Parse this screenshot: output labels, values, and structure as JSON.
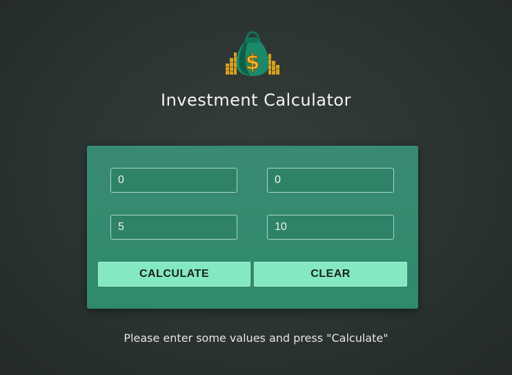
{
  "app": {
    "title": "Investment Calculator",
    "logo_icon": "money-bag-icon"
  },
  "form": {
    "fields": [
      {
        "value": "0"
      },
      {
        "value": "0"
      },
      {
        "value": "5"
      },
      {
        "value": "10"
      }
    ],
    "calculate_label": "CALCULATE",
    "clear_label": "CLEAR"
  },
  "status": {
    "message": "Please enter some values and press \"Calculate\""
  },
  "colors": {
    "background": "#2b3431",
    "card": "#2f8a6b",
    "button": "#84e8c1"
  }
}
